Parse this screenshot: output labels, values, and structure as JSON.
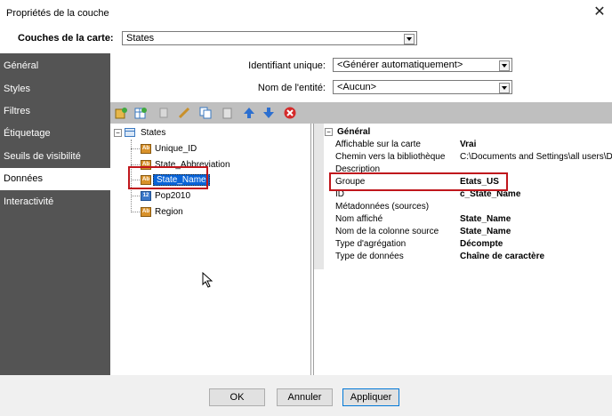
{
  "window": {
    "title": "Propriétés de la couche"
  },
  "layer": {
    "label": "Couches de la carte:",
    "value": "States"
  },
  "sidebar": {
    "items": [
      {
        "label": "Général"
      },
      {
        "label": "Styles"
      },
      {
        "label": "Filtres"
      },
      {
        "label": "Étiquetage"
      },
      {
        "label": "Seuils de visibilité"
      },
      {
        "label": "Données"
      },
      {
        "label": "Interactivité"
      }
    ],
    "active_index": 5
  },
  "fields": {
    "unique_id": {
      "label": "Identifiant unique:",
      "value": "<Générer automatiquement>"
    },
    "entity_name": {
      "label": "Nom de l'entité:",
      "value": "<Aucun>"
    }
  },
  "toolbar": {
    "icons": [
      "add-field-icon",
      "add-table-icon",
      "copy-icon",
      "edit-pencil-icon",
      "duplicate-icon",
      "paste-icon",
      "move-up-icon",
      "move-down-icon",
      "delete-icon"
    ]
  },
  "tree": {
    "root": "States",
    "children": [
      {
        "label": "Unique_ID",
        "type": "text"
      },
      {
        "label": "State_Abbreviation",
        "type": "text"
      },
      {
        "label": "State_Name",
        "type": "text",
        "selected": true
      },
      {
        "label": "Pop2010",
        "type": "number"
      },
      {
        "label": "Region",
        "type": "text"
      }
    ]
  },
  "properties": {
    "section": "Général",
    "rows": [
      {
        "name": "Affichable sur la carte",
        "value": "Vrai",
        "bold": true
      },
      {
        "name": "Chemin vers la bibliothèque",
        "value": "C:\\Documents and Settings\\all users\\Do",
        "bold": false
      },
      {
        "name": "Description",
        "value": "",
        "bold": false
      },
      {
        "name": "Groupe",
        "value": "Etats_US",
        "bold": true
      },
      {
        "name": "ID",
        "value": "c_State_Name",
        "bold": true
      },
      {
        "name": "Métadonnées (sources)",
        "value": "",
        "bold": false
      },
      {
        "name": "Nom affiché",
        "value": "State_Name",
        "bold": true
      },
      {
        "name": "Nom de la colonne source",
        "value": "State_Name",
        "bold": true
      },
      {
        "name": "Type d'agrégation",
        "value": "Décompte",
        "bold": true
      },
      {
        "name": "Type de données",
        "value": "Chaîne de caractère",
        "bold": true
      }
    ]
  },
  "buttons": {
    "ok": "OK",
    "cancel": "Annuler",
    "apply": "Appliquer"
  },
  "colors": {
    "sidebar": "#545454",
    "highlight": "#0a64d8",
    "annotation": "#c0161c"
  }
}
